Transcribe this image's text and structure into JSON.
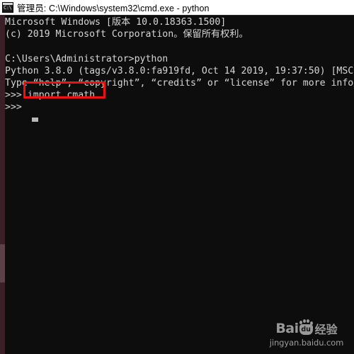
{
  "window": {
    "title": "管理员: C:\\Windows\\system32\\cmd.exe - python",
    "icon_name": "cmd-exe-icon",
    "icon_text": "C:\\",
    "titlebar_bg": "#ffffff",
    "titlebar_fg": "#000000"
  },
  "terminal": {
    "background": "#0d0d0d",
    "foreground": "#d6d6d6",
    "lines": [
      "Microsoft Windows [版本 10.0.18363.1500]",
      "(c) 2019 Microsoft Corporation。保留所有权利。",
      "",
      "C:\\Users\\Administrator>python",
      "Python 3.8.0 (tags/v3.8.0:fa919fd, Oct 14 2019, 19:37:50) [MSC",
      "Type “help”, “copyright”, “credits” or “license” for more info",
      ">>> import cmath",
      ">>>"
    ],
    "cursor": "block-cursor"
  },
  "scrollbar": {
    "track_color": "#3b1f26",
    "thumb_color": "#5d4149"
  },
  "annotation": {
    "label": "import cmath",
    "color": "#ee1111"
  },
  "watermark": {
    "brand": "Bai",
    "badge": "du",
    "suffix": "经验",
    "url": "jingyan.baidu.com"
  }
}
